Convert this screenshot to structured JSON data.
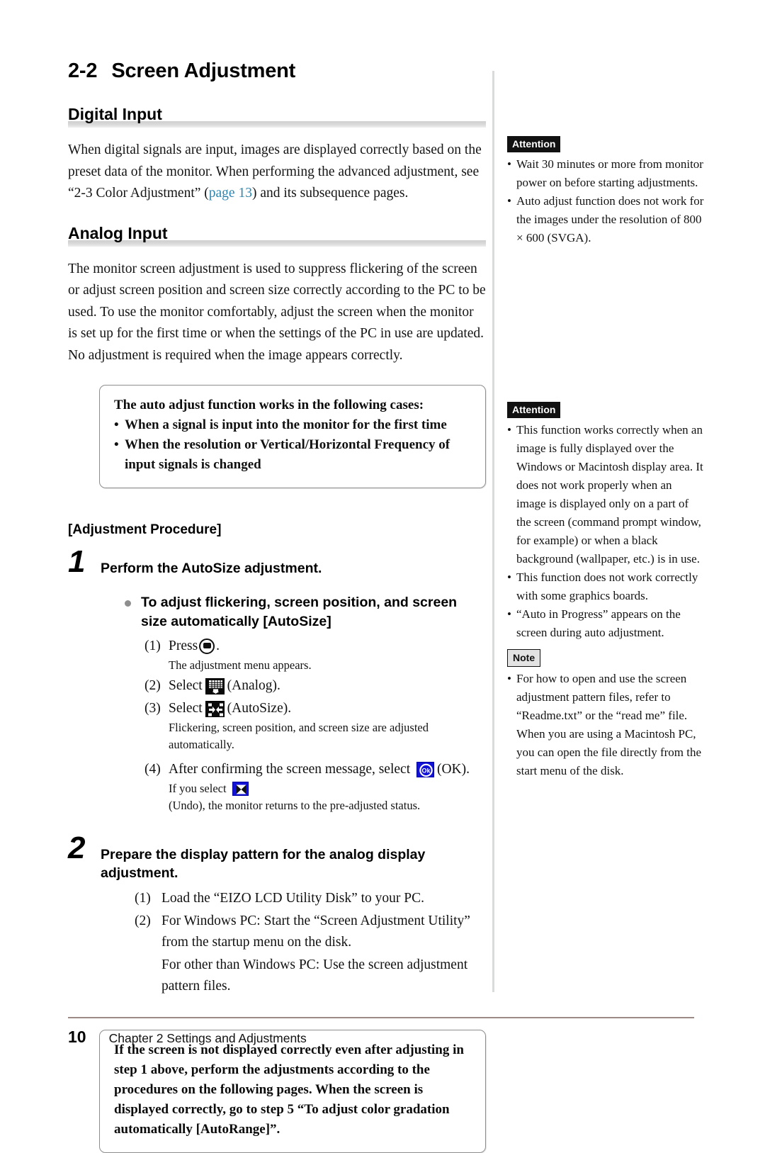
{
  "section": {
    "number": "2-2",
    "title": "Screen Adjustment"
  },
  "digital": {
    "heading": "Digital Input",
    "para_before_link": "When digital signals are input, images are displayed correctly based on the preset data of the monitor. When performing the advanced adjustment, see “2-3 Color Adjustment” (",
    "link_text": "page 13",
    "para_after_link": ") and its subsequence pages.",
    "link_color": "#2f86b0"
  },
  "analog": {
    "heading": "Analog Input",
    "paragraph": "The monitor screen adjustment is used to suppress flickering of the screen or adjust screen position and screen size correctly according to the PC to be used. To use the monitor comfortably, adjust the screen when the monitor is set up for the first time or when the settings of the PC in use are updated. No adjustment is required when the image appears correctly."
  },
  "callout_top": {
    "title": "The auto adjust function works in the following cases:",
    "bullets": [
      "When a signal is input into the monitor for the first time",
      "When the resolution or Vertical/Horizontal Frequency of input signals is changed"
    ],
    "bullet_mark": "•"
  },
  "procedure": {
    "label": "[Adjustment Procedure]"
  },
  "step1": {
    "number": "1",
    "title": "Perform the AutoSize adjustment.",
    "subbullet": "To adjust flickering, screen position, and screen size automatically [AutoSize]",
    "items": [
      {
        "mark": "(1)",
        "text_before": "Press",
        "icon": "osd-menu-icon",
        "text_after": ".",
        "note": "The adjustment menu appears."
      },
      {
        "mark": "(2)",
        "text_before": "Select",
        "icon": "osd-analog-icon",
        "text_after": "(Analog).",
        "note": ""
      },
      {
        "mark": "(3)",
        "text_before": "Select",
        "icon": "osd-autosize-icon",
        "text_after": "(AutoSize).",
        "note": "Flickering, screen position, and screen size are adjusted automatically."
      },
      {
        "mark": "(4)",
        "text_before": "After confirming the screen message, select",
        "icon": "osd-ok-icon",
        "text_after": "(OK).",
        "note": ""
      }
    ],
    "undo_note_before": "If you select",
    "undo_icon": "osd-undo-icon",
    "undo_note_after": "(Undo), the monitor returns to the pre-adjusted status."
  },
  "step2": {
    "number": "2",
    "title": "Prepare the display pattern for the analog display adjustment.",
    "items": [
      {
        "mark": "(1)",
        "text": "Load the “EIZO LCD Utility Disk” to your PC."
      },
      {
        "mark": "(2)",
        "text": "For Windows PC: Start the “Screen Adjustment Utility” from the startup menu on the disk."
      }
    ],
    "extra_line": "For other than Windows PC: Use the screen adjustment pattern files."
  },
  "callout_bottom": {
    "text": "If the screen is not displayed correctly even after adjusting in step 1 above, perform the adjustments according to the procedures on the following pages. When the screen is displayed correctly, go to step 5 “To adjust color gradation automatically [AutoRange]”."
  },
  "sidebar": {
    "blocks": [
      {
        "tag": "Attention",
        "tag_style": "attention",
        "bullets": [
          "Wait 30 minutes or more from monitor power on before starting adjustments.",
          "Auto adjust function does not work for the images under the resolution of 800 × 600 (SVGA)."
        ]
      },
      {
        "tag": "Attention",
        "tag_style": "attention",
        "bullets": [
          "This function works correctly when an image is fully displayed over the Windows or Macintosh display area. It does not work properly when an image is displayed only on a part of the screen (command prompt window, for example) or when a black background (wallpaper, etc.) is in use.",
          "This function does not work correctly with some graphics boards.",
          "“Auto in Progress” appears on the screen during auto adjustment."
        ]
      },
      {
        "tag": "Note",
        "tag_style": "note",
        "bullets": [
          "For how to open and use the screen adjustment pattern files, refer to “Readme.txt” or the “read me” file. When you are using a Macintosh PC, you can open the file directly from the start menu of the disk."
        ]
      }
    ],
    "bullet_mark": "•"
  },
  "footer": {
    "page_number": "10",
    "chapter_text": "Chapter 2  Settings and Adjustments"
  }
}
